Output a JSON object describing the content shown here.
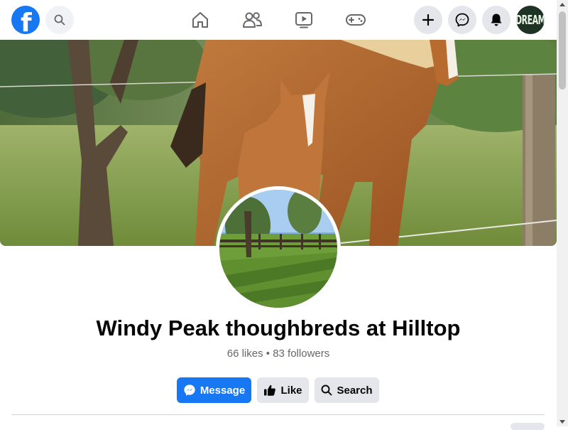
{
  "header": {
    "logo_letter": "f",
    "avatar_text": "DREAM",
    "icons": [
      "facebook-logo",
      "search-icon",
      "home-icon",
      "friends-icon",
      "watch-icon",
      "gaming-icon",
      "plus-icon",
      "messenger-icon",
      "notifications-bell-icon"
    ]
  },
  "page": {
    "title": "Windy Peak thoughbreds at Hilltop",
    "stats": "66 likes • 83 followers"
  },
  "actions": {
    "message_label": "Message",
    "like_label": "Like",
    "search_label": "Search"
  },
  "colors": {
    "brand": "#1877f2",
    "button_gray": "#e4e6eb",
    "secondary_text": "#65676b"
  }
}
